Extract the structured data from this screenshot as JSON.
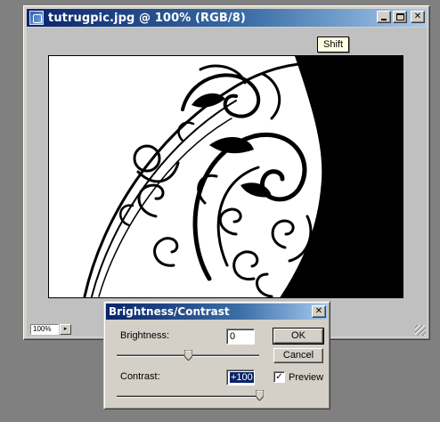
{
  "document_window": {
    "title": "tutrugpic.jpg @ 100% (RGB/8)",
    "icon": "photoshop-document-icon",
    "caption_buttons": {
      "minimize": "minimize-icon",
      "maximize": "maximize-icon",
      "close": "✕"
    },
    "tooltip": "Shift",
    "status_bar": {
      "zoom": "100%",
      "menu_arrow": "▸"
    }
  },
  "dialog": {
    "title": "Brightness/Contrast",
    "close_glyph": "✕",
    "brightness": {
      "label": "Brightness:",
      "value": "0",
      "level": 0.5
    },
    "contrast": {
      "label": "Contrast:",
      "value": "+100",
      "level": 1.0
    },
    "buttons": {
      "ok": "OK",
      "cancel": "Cancel"
    },
    "preview": {
      "label": "Preview",
      "checked": true,
      "check_glyph": "✓"
    }
  },
  "colors": {
    "title_active": "#0a246a",
    "title_gradient_end": "#a6caf0",
    "face": "#d4d0c8",
    "desktop": "#808080"
  }
}
